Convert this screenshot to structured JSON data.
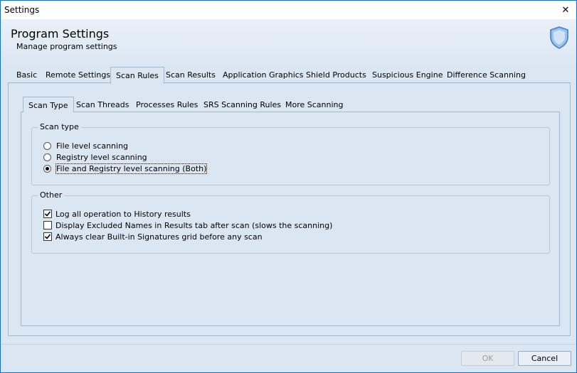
{
  "window": {
    "title": "Settings",
    "close_glyph": "✕"
  },
  "header": {
    "title": "Program Settings",
    "subtitle": "Manage program settings",
    "icon": "shield-icon",
    "accent": "#4a8fd8"
  },
  "main_tabs": [
    {
      "label": "Basic",
      "active": false
    },
    {
      "label": "Remote Settings",
      "active": false
    },
    {
      "label": "Scan Rules",
      "active": true
    },
    {
      "label": "Scan Results",
      "active": false
    },
    {
      "label": "Application Graphics",
      "active": false
    },
    {
      "label": "Shield Products",
      "active": false
    },
    {
      "label": "Suspicious Engine",
      "active": false
    },
    {
      "label": "Difference Scanning",
      "active": false
    }
  ],
  "sub_tabs": [
    {
      "label": "Scan Type",
      "active": true
    },
    {
      "label": "Scan Threads",
      "active": false
    },
    {
      "label": "Processes Rules",
      "active": false
    },
    {
      "label": "SRS Scanning Rules",
      "active": false
    },
    {
      "label": "More Scanning",
      "active": false
    }
  ],
  "scan_type": {
    "legend": "Scan type",
    "options": [
      {
        "label": "File level scanning",
        "selected": false
      },
      {
        "label": "Registry level scanning",
        "selected": false
      },
      {
        "label": "File and Registry level scanning (Both)",
        "selected": true
      }
    ]
  },
  "other": {
    "legend": "Other",
    "options": [
      {
        "label": "Log all operation to History results",
        "checked": true
      },
      {
        "label": "Display Excluded Names in Results tab after scan (slows the scanning)",
        "checked": false
      },
      {
        "label": "Always clear Built-in Signatures grid before any scan",
        "checked": true
      }
    ]
  },
  "buttons": {
    "ok": "OK",
    "cancel": "Cancel"
  }
}
